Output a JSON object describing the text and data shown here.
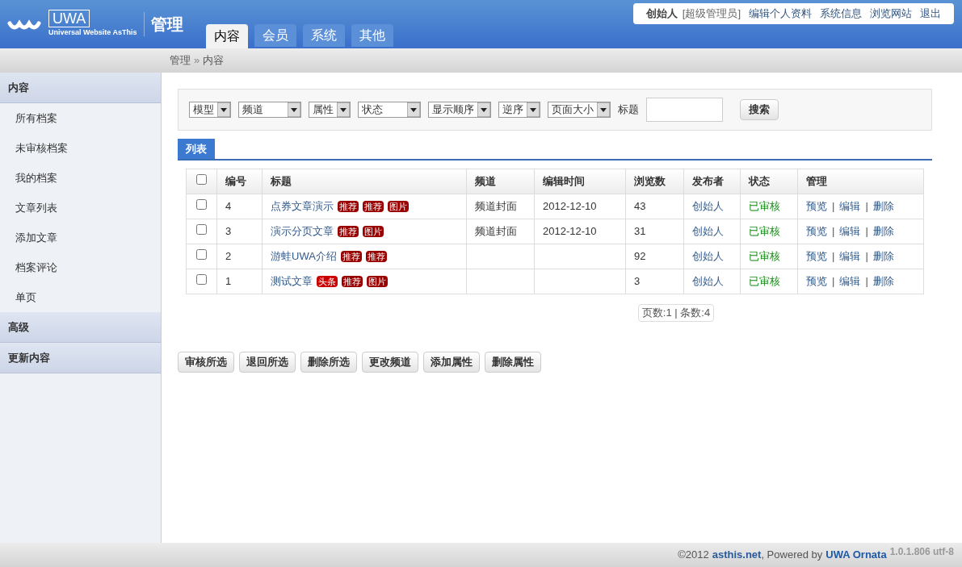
{
  "logo": {
    "brand": "UWA",
    "tagline": "Universal Website AsThis",
    "title": "管理"
  },
  "tabs": [
    {
      "label": "内容",
      "selected": true
    },
    {
      "label": "会员",
      "selected": false
    },
    {
      "label": "系统",
      "selected": false
    },
    {
      "label": "其他",
      "selected": false
    }
  ],
  "user_bar": {
    "name": "创始人",
    "role": "[超级管理员]",
    "links": [
      "编辑个人资料",
      "系统信息",
      "浏览网站",
      "退出"
    ]
  },
  "breadcrumb": {
    "items": [
      "管理",
      "内容"
    ],
    "separator": "»"
  },
  "sidebar": [
    {
      "label": "内容",
      "items": [
        "所有档案",
        "未审核档案",
        "我的档案",
        "文章列表",
        "添加文章",
        "档案评论",
        "单页"
      ]
    },
    {
      "label": "高级"
    },
    {
      "label": "更新内容"
    }
  ],
  "filters": [
    "模型",
    "频道",
    "属性",
    "状态",
    "显示顺序",
    "逆序",
    "页面大小"
  ],
  "title_field": {
    "label": "标题"
  },
  "search_button": "搜索",
  "list_tab": "列表",
  "table": {
    "select_all_checked": false,
    "columns": [
      "编号",
      "标题",
      "频道",
      "编辑时间",
      "浏览数",
      "发布者",
      "状态",
      "管理"
    ],
    "rows": [
      {
        "checked": false,
        "id": "4",
        "title": "点券文章演示",
        "tags": [
          {
            "label": "推荐",
            "color": "#990000"
          },
          {
            "label": "推荐",
            "color": "#990000"
          },
          {
            "label": "图片",
            "color": "#990000"
          }
        ],
        "channel": "频道封面",
        "time": "2012-12-10",
        "views": "43",
        "author": "创始人",
        "status": "已审核",
        "actions": [
          {
            "label": "预览"
          },
          {
            "separator": "|",
            "label": "编辑"
          },
          {
            "separator": "|",
            "label": "删除"
          }
        ]
      },
      {
        "checked": false,
        "id": "3",
        "title": "演示分页文章",
        "tags": [
          {
            "label": "推荐",
            "color": "#990000"
          },
          {
            "label": "图片",
            "color": "#990000"
          }
        ],
        "channel": "频道封面",
        "time": "2012-12-10",
        "views": "31",
        "author": "创始人",
        "status": "已审核",
        "actions": [
          {
            "label": "预览"
          },
          {
            "separator": "|",
            "label": "编辑"
          },
          {
            "separator": "|",
            "label": "删除"
          }
        ]
      },
      {
        "checked": false,
        "id": "2",
        "title": "游蛙UWA介绍",
        "tags": [
          {
            "label": "推荐",
            "color": "#990000"
          },
          {
            "label": "推荐",
            "color": "#990000"
          }
        ],
        "views": "92",
        "author": "创始人",
        "status": "已审核",
        "actions": [
          {
            "label": "预览"
          },
          {
            "separator": "|",
            "label": "编辑"
          },
          {
            "separator": "|",
            "label": "删除"
          }
        ]
      },
      {
        "checked": false,
        "id": "1",
        "title": "测试文章",
        "tags": [
          {
            "label": "头条",
            "color": "#cc0000"
          },
          {
            "label": "推荐",
            "color": "#990000"
          },
          {
            "label": "图片",
            "color": "#990000"
          }
        ],
        "views": "3",
        "author": "创始人",
        "status": "已审核",
        "actions": [
          {
            "label": "预览"
          },
          {
            "separator": "|",
            "label": "编辑"
          },
          {
            "separator": "|",
            "label": "删除"
          }
        ]
      }
    ]
  },
  "pagination": "页数:1 | 条数:4",
  "actions": [
    "审核所选",
    "退回所选",
    "删除所选",
    "更改频道",
    "添加属性",
    "删除属性"
  ],
  "footer": {
    "copyright": "©2012",
    "site": "asthis.net",
    "powered": ", Powered by",
    "product": "UWA Ornata",
    "version": "1.0.1.806 utf-8"
  }
}
